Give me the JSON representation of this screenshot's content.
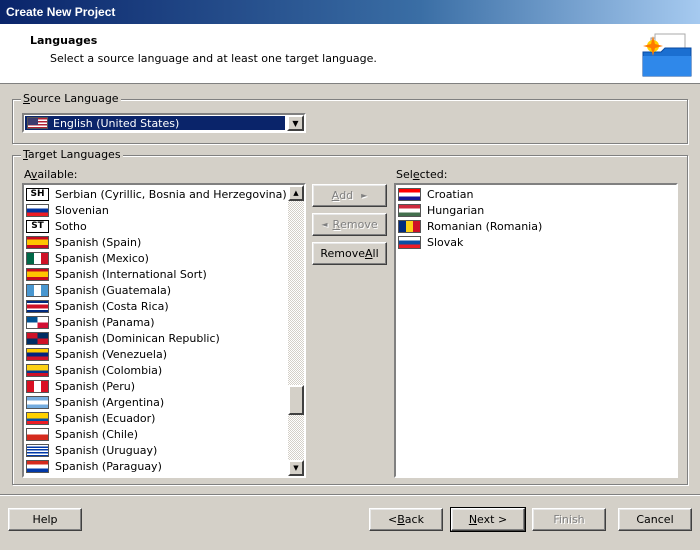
{
  "window": {
    "title": "Create New Project"
  },
  "header": {
    "title": "Languages",
    "subtitle": "Select a source language and at least one target language.",
    "icon": "new-project-folder-icon"
  },
  "source": {
    "legend_u": "S",
    "legend_rest": "ource Language",
    "selected": "English (United States)",
    "flag": "us"
  },
  "target": {
    "legend_u": "T",
    "legend_rest": "arget Languages",
    "available_label_pre": "A",
    "available_label_u": "v",
    "available_label_post": "ailable:",
    "selected_label_pre": "Sel",
    "selected_label_u": "e",
    "selected_label_post": "cted:",
    "available": [
      {
        "label": "Serbian (Cyrillic, Bosnia and Herzegovina)",
        "flag": "code",
        "code": "SH"
      },
      {
        "label": "Slovenian",
        "flag": "si"
      },
      {
        "label": "Sotho",
        "flag": "code",
        "code": "ST"
      },
      {
        "label": "Spanish (Spain)",
        "flag": "es"
      },
      {
        "label": "Spanish (Mexico)",
        "flag": "mx"
      },
      {
        "label": "Spanish (International Sort)",
        "flag": "es"
      },
      {
        "label": "Spanish (Guatemala)",
        "flag": "gt"
      },
      {
        "label": "Spanish (Costa Rica)",
        "flag": "cr"
      },
      {
        "label": "Spanish (Panama)",
        "flag": "pa"
      },
      {
        "label": "Spanish (Dominican Republic)",
        "flag": "do"
      },
      {
        "label": "Spanish (Venezuela)",
        "flag": "ve"
      },
      {
        "label": "Spanish (Colombia)",
        "flag": "co"
      },
      {
        "label": "Spanish (Peru)",
        "flag": "pe"
      },
      {
        "label": "Spanish (Argentina)",
        "flag": "ar"
      },
      {
        "label": "Spanish (Ecuador)",
        "flag": "ec"
      },
      {
        "label": "Spanish (Chile)",
        "flag": "cl"
      },
      {
        "label": "Spanish (Uruguay)",
        "flag": "uy"
      },
      {
        "label": "Spanish (Paraguay)",
        "flag": "py"
      }
    ],
    "selected": [
      {
        "label": "Croatian",
        "flag": "hr"
      },
      {
        "label": "Hungarian",
        "flag": "hu"
      },
      {
        "label": "Romanian (Romania)",
        "flag": "ro"
      },
      {
        "label": "Slovak",
        "flag": "sk"
      }
    ],
    "add_label_u": "A",
    "add_label_rest": "dd",
    "remove_label_u": "R",
    "remove_label_rest": "emove",
    "remove_all_pre": "Remove ",
    "remove_all_u": "A",
    "remove_all_post": "ll"
  },
  "footer": {
    "help": "Help",
    "back_u": "B",
    "back_rest": "ack",
    "next_u": "N",
    "next_rest": "ext >",
    "finish": "Finish",
    "cancel": "Cancel"
  },
  "flag_colors": {
    "us_blue": "#3c3b6e",
    "us_red": "#b22234",
    "es_red": "#c60b1e",
    "es_yellow": "#ffc400"
  }
}
